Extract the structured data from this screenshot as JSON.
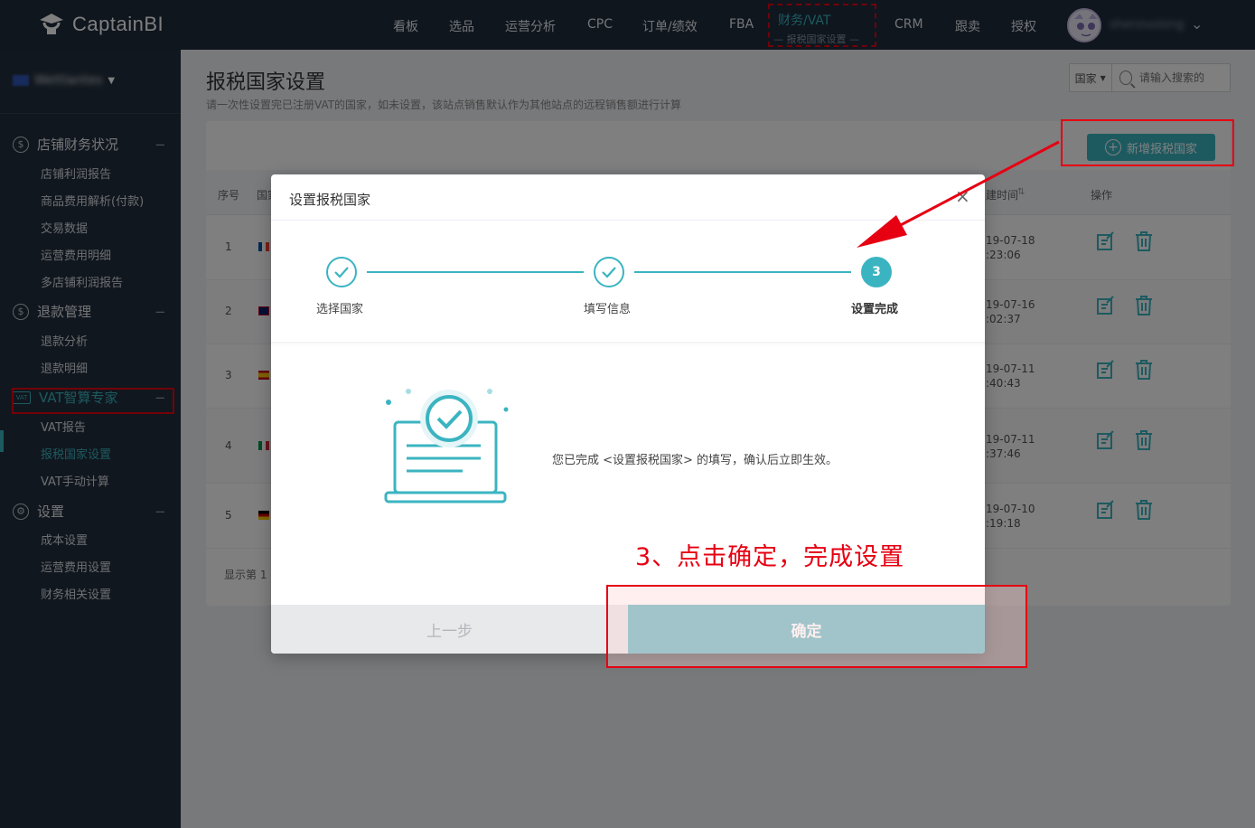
{
  "brand": {
    "name": "CaptainBI"
  },
  "top_nav": {
    "items": [
      "看板",
      "选品",
      "运营分析",
      "CPC",
      "订单/绩效",
      "FBA",
      "财务/VAT",
      "CRM",
      "跟卖",
      "授权"
    ],
    "active_sub": "— 报税国家设置 —",
    "username": "shenzuolong"
  },
  "sidebar": {
    "store_name": "Wettlantes",
    "groups": [
      {
        "label": "店铺财务状况",
        "icon": "dollar-icon",
        "items": [
          "店铺利润报告",
          "商品费用解析(付款)",
          "交易数据",
          "运营费用明细",
          "多店铺利润报告"
        ]
      },
      {
        "label": "退款管理",
        "icon": "refund-icon",
        "items": [
          "退款分析",
          "退款明细"
        ]
      },
      {
        "label": "VAT智算专家",
        "icon": "vat-icon",
        "items": [
          "VAT报告",
          "报税国家设置",
          "VAT手动计算"
        ]
      },
      {
        "label": "设置",
        "icon": "gear-icon",
        "items": [
          "成本设置",
          "运营费用设置",
          "财务相关设置"
        ]
      }
    ],
    "collapse_symbol": "−",
    "vat_icon_text": "VAT"
  },
  "page": {
    "title": "报税国家设置",
    "description": "请一次性设置完已注册VAT的国家，如未设置，该站点销售默认作为其他站点的远程销售额进行计算",
    "search_select": "国家",
    "search_placeholder": "请输入搜索的",
    "add_button": "新增报税国家",
    "columns": {
      "index": "序号",
      "country": "国家",
      "time": "建时间",
      "ops": "操作"
    },
    "rows": [
      {
        "index": "1",
        "date": "19-07-18",
        "time": ":23:06",
        "flag": "france-flag"
      },
      {
        "index": "2",
        "date": "19-07-16",
        "time": ":02:37",
        "flag": "uk-flag"
      },
      {
        "index": "3",
        "date": "19-07-11",
        "time": ":40:43",
        "flag": "spain-flag"
      },
      {
        "index": "4",
        "date": "19-07-11",
        "time": ":37:46",
        "flag": "italy-flag"
      },
      {
        "index": "5",
        "date": "19-07-10",
        "time": ":19:18",
        "flag": "germany-flag"
      }
    ],
    "footer": "显示第 1"
  },
  "modal": {
    "title": "设置报税国家",
    "close": "×",
    "steps": [
      {
        "label": "选择国家",
        "state": "done"
      },
      {
        "label": "填写信息",
        "state": "done"
      },
      {
        "label": "设置完成",
        "state": "current",
        "number": "3"
      }
    ],
    "message": "您已完成 <设置报税国家> 的填写，确认后立即生效。",
    "prev_button": "上一步",
    "ok_button": "确定"
  },
  "annotation": {
    "text": "3、点击确定，完成设置"
  },
  "colors": {
    "accent": "#3bb4c1",
    "annotation": "#e60012",
    "nav_bg": "#1f2d3d",
    "sidebar_bg": "#232f3d"
  }
}
